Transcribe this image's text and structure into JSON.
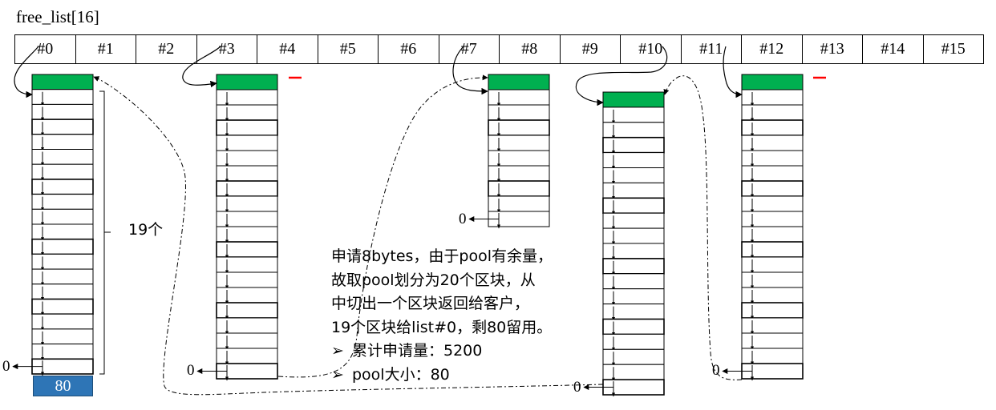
{
  "title": "free_list[16]",
  "array_cells": [
    "#0",
    "#1",
    "#2",
    "#3",
    "#4",
    "#5",
    "#6",
    "#7",
    "#8",
    "#9",
    "#10",
    "#11",
    "#12",
    "#13",
    "#14",
    "#15"
  ],
  "columns": [
    {
      "name": "list-0",
      "blocks": 20,
      "marked": false
    },
    {
      "name": "list-3",
      "blocks": 20,
      "marked": true
    },
    {
      "name": "list-7",
      "blocks": 10,
      "marked": false
    },
    {
      "name": "list-10",
      "blocks": 20,
      "marked": false
    },
    {
      "name": "list-12",
      "blocks": 20,
      "marked": true
    }
  ],
  "null_label": "0",
  "count_label": "19个",
  "pool_label": "80",
  "note": {
    "lines": [
      "申请8bytes，由于pool有余量，",
      "故取pool划分为20个区块，从",
      "中切出一个区块返回给客户，",
      "19个区块给list#0，剩80留用。"
    ],
    "bullets": [
      "累计申请量：5200",
      "pool大小：80"
    ]
  },
  "colors": {
    "head_block": "#00b050",
    "pool_block": "#2e75b6",
    "marker": "#ff0000"
  }
}
